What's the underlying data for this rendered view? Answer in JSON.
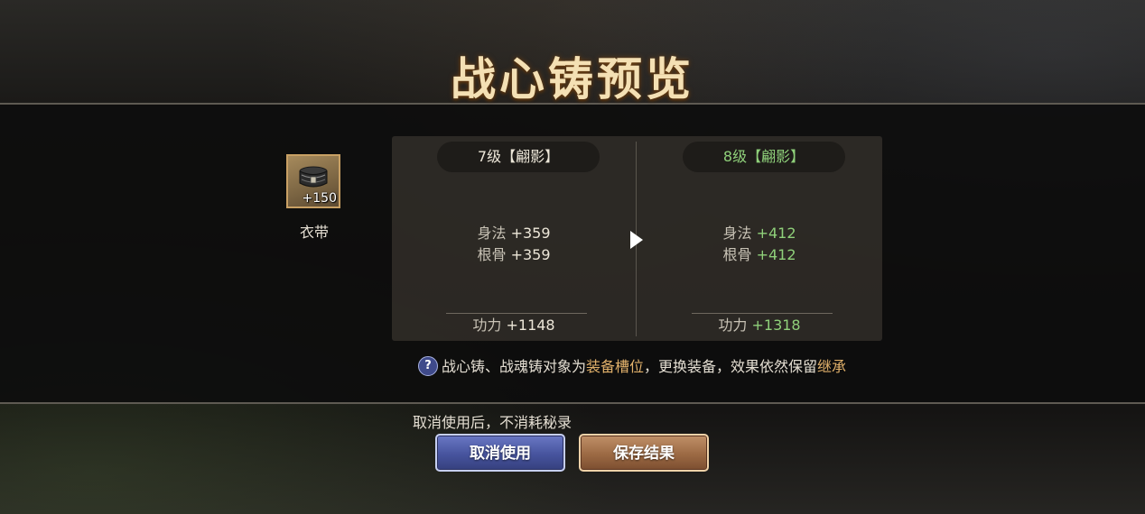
{
  "title": "战心铸预览",
  "equipment": {
    "name": "衣带",
    "bonus": "+150",
    "icon": "belt-icon"
  },
  "current": {
    "level": "7级【翩影】",
    "stats": [
      {
        "name": "身法",
        "value": "+359"
      },
      {
        "name": "根骨",
        "value": "+359"
      }
    ],
    "power_label": "功力",
    "power_value": "+1148"
  },
  "next": {
    "level": "8级【翩影】",
    "stats": [
      {
        "name": "身法",
        "value": "+412"
      },
      {
        "name": "根骨",
        "value": "+412"
      }
    ],
    "power_label": "功力",
    "power_value": "+1318"
  },
  "tip": {
    "icon_glyph": "?",
    "part1": "战心铸、战魂铸对象为",
    "highlight1": "装备槽位",
    "part2": "，更换装备，效果依然保留",
    "highlight2": "继承"
  },
  "notice": "取消使用后，不消耗秘录",
  "buttons": {
    "cancel": "取消使用",
    "save": "保存结果"
  },
  "colors": {
    "title": "#f4e0b4",
    "upgrade_value": "#8fd07a",
    "highlight": "#e0b06a",
    "cancel_button": "#47549e",
    "save_button": "#9c6a44"
  }
}
